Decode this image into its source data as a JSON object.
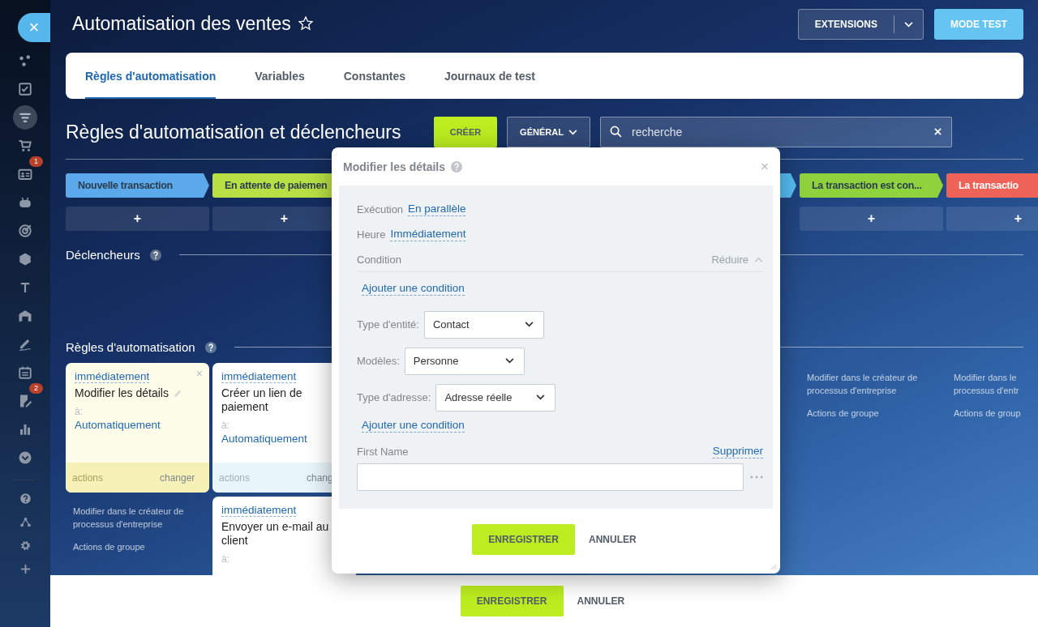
{
  "sidebar": {
    "close": "×",
    "items": [
      {
        "selected": false
      },
      {
        "selected": false
      },
      {
        "selected": true
      },
      {
        "selected": false
      },
      {
        "selected": false,
        "badge": "1"
      },
      {
        "selected": false
      },
      {
        "selected": false
      },
      {
        "selected": false
      },
      {
        "selected": false
      },
      {
        "selected": false
      },
      {
        "selected": false
      },
      {
        "selected": false
      },
      {
        "selected": false,
        "badge": "2"
      },
      {
        "selected": false
      },
      {
        "selected": false
      }
    ],
    "bottom_items": [
      {
        "selected": false
      },
      {
        "selected": false
      },
      {
        "selected": false
      },
      {
        "selected": false
      }
    ]
  },
  "header": {
    "title": "Automatisation des ventes",
    "favorite": false,
    "buttons": [
      {
        "label": "EXTENSIONS",
        "kind": "split"
      },
      {
        "label": "MODE TEST",
        "kind": "primary"
      }
    ]
  },
  "tabs": [
    {
      "label": "Règles d'automatisation",
      "selected": true
    },
    {
      "label": "Variables",
      "selected": false
    },
    {
      "label": "Constantes",
      "selected": false
    },
    {
      "label": "Journaux de test",
      "selected": false
    }
  ],
  "toolbar": {
    "title": "Règles d'automatisation et déclencheurs",
    "create": "CRÉER",
    "filter": "GÉNÉRAL",
    "search": {
      "placeholder": "recherche"
    }
  },
  "stages": [
    {
      "label": "Nouvelle transaction",
      "color": "#5ba8ea",
      "add": "+"
    },
    {
      "label": "En attente de paiemen",
      "color": "#b8e044",
      "add": "+"
    },
    {
      "color": "#55bdf2"
    },
    {
      "label": "La transaction est con...",
      "color": "#8fd23e",
      "add": "+"
    },
    {
      "label": "La transactio",
      "color": "#ee6258",
      "add": "+"
    }
  ],
  "triggers": {
    "title": "Déclencheurs"
  },
  "rules": {
    "title": "Règles d'automatisation",
    "columns": [
      {
        "cards": [
          {
            "timing": "immédiatement",
            "title": "Modifier les détails",
            "to": "à:",
            "responsible": "Automatiquement",
            "footer_left": "actions",
            "footer_right": "changer",
            "selected": true,
            "close": "×"
          }
        ],
        "links": [
          "Modifier dans le créateur de processus d'entreprise",
          "Actions de groupe"
        ]
      },
      {
        "cards": [
          {
            "timing": "immédiatement",
            "title": "Créer un lien de paiement",
            "to": "à:",
            "responsible": "Automatiquement",
            "footer_left": "actions",
            "footer_right": "chang",
            "selected": false
          },
          {
            "timing": "immédiatement",
            "title": "Envoyer un e-mail au client",
            "to": "à:",
            "selected": false
          }
        ]
      },
      {},
      {},
      {},
      {
        "links": [
          "Modifier dans le créateur de processus d'entreprise",
          "Actions de groupe"
        ]
      },
      {
        "links": [
          "Modifier dans le\nprocessus d'entr",
          "Actions de group"
        ]
      }
    ]
  },
  "dialog": {
    "title": "Modifier les détails",
    "close": "×",
    "rows": [
      {
        "kind": "link",
        "label": "Exécution",
        "value": "En parallèle"
      },
      {
        "kind": "link",
        "label": "Heure",
        "value": "Immédiatement"
      },
      {
        "kind": "section",
        "label": "Condition",
        "action": "Réduire",
        "expanded": true
      },
      {
        "kind": "add",
        "label": "Ajouter une condition"
      },
      {
        "kind": "select",
        "label": "Type d'entité:",
        "value": "Contact"
      },
      {
        "kind": "select",
        "label": "Modèles:",
        "value": "Personne"
      },
      {
        "kind": "select",
        "label": "Type d'adresse:",
        "value": "Adresse réelle"
      },
      {
        "kind": "add",
        "label": "Ajouter une condition"
      },
      {
        "kind": "field",
        "label": "First Name",
        "action": "Supprimer"
      }
    ],
    "buttons": [
      {
        "label": "ENREGISTRER",
        "kind": "primary"
      },
      {
        "label": "ANNULER",
        "kind": "plain"
      }
    ]
  },
  "footer": {
    "buttons": [
      {
        "label": "ENREGISTRER",
        "kind": "primary"
      },
      {
        "label": "ANNULER",
        "kind": "plain"
      }
    ]
  }
}
